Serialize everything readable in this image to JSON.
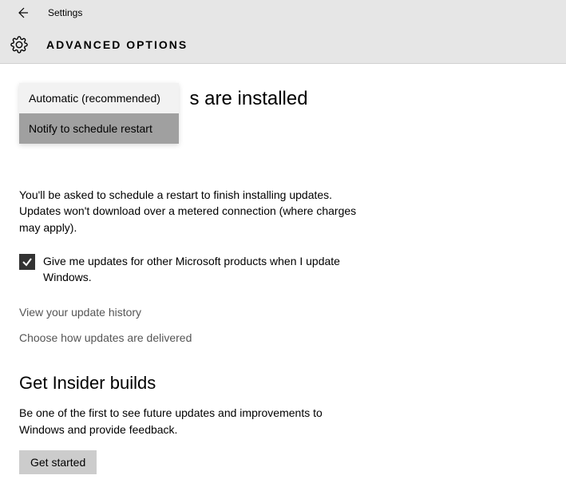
{
  "titlebar": {
    "title": "Settings"
  },
  "header": {
    "title": "ADVANCED OPTIONS"
  },
  "main": {
    "heading_partial": "s are installed",
    "dropdown": {
      "options": [
        {
          "label": "Automatic (recommended)",
          "selected": false
        },
        {
          "label": "Notify to schedule restart",
          "selected": true
        }
      ]
    },
    "description": "You'll be asked to schedule a restart to finish installing updates. Updates won't download over a metered connection (where charges may apply).",
    "checkbox": {
      "checked": true,
      "label": "Give me updates for other Microsoft products when I update Windows."
    },
    "links": {
      "history": "View your update history",
      "delivery": "Choose how updates are delivered"
    }
  },
  "insider": {
    "heading": "Get Insider builds",
    "description": "Be one of the first to see future updates and improvements to Windows and provide feedback.",
    "button": "Get started"
  }
}
